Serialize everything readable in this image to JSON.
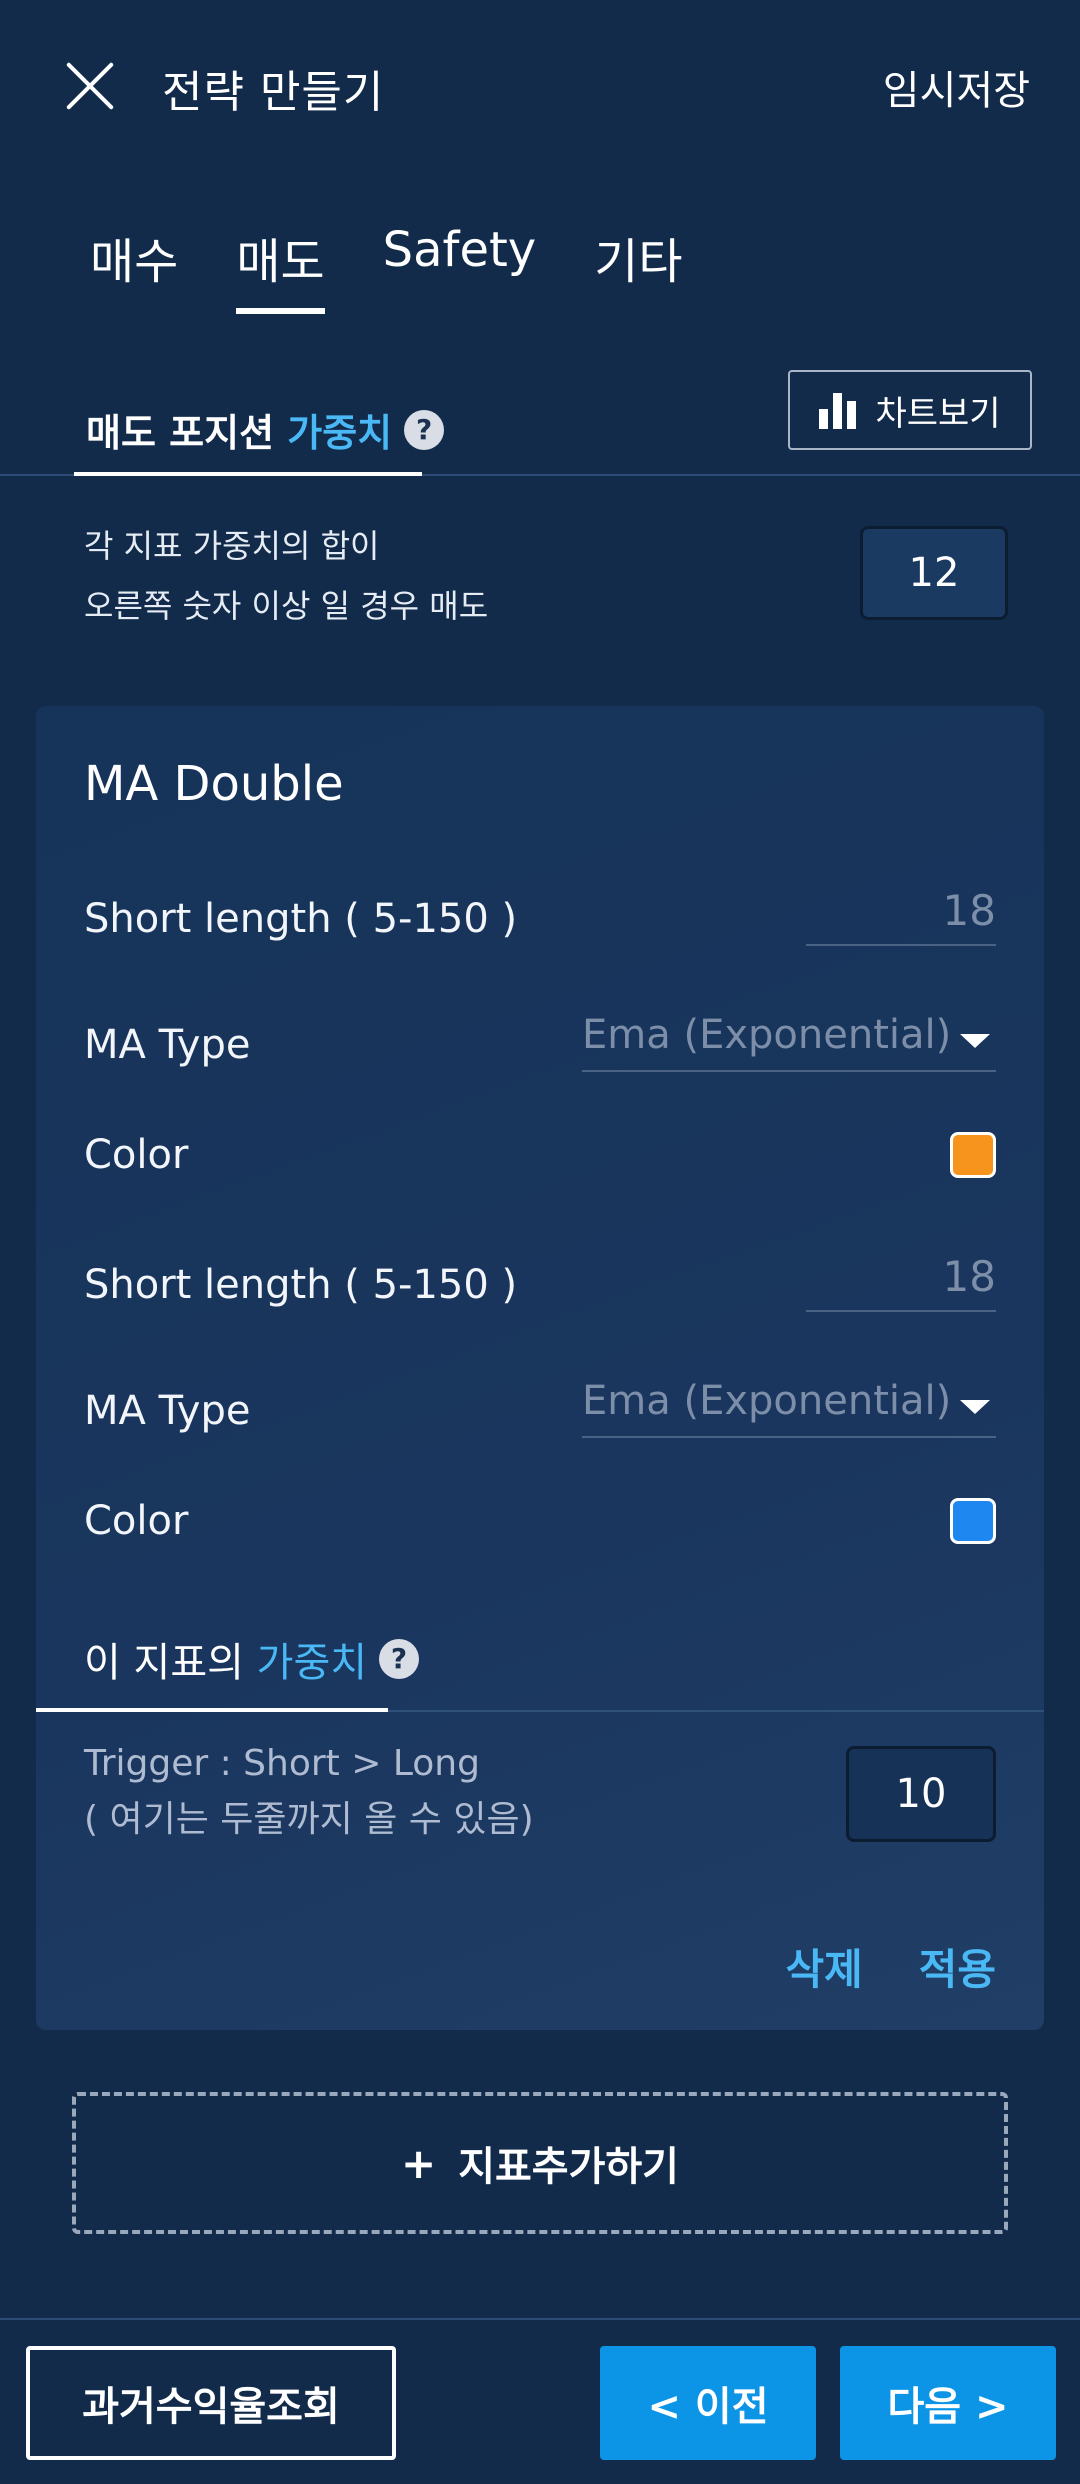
{
  "header": {
    "title": "전략 만들기",
    "save_label": "임시저장"
  },
  "tabs": [
    {
      "label": "매수",
      "active": false
    },
    {
      "label": "매도",
      "active": true
    },
    {
      "label": "Safety",
      "active": false
    },
    {
      "label": "기타",
      "active": false
    }
  ],
  "section": {
    "title_prefix": "매도 포지션",
    "title_accent": "가중치",
    "help_glyph": "?",
    "chart_button_label": "차트보기",
    "threshold_line1": "각 지표 가중치의 합이",
    "threshold_line2": "오른쪽 숫자 이상 일 경우 매도",
    "threshold_value": "12"
  },
  "indicator_card": {
    "title": "MA Double",
    "short1_label": "Short length ( 5-150 )",
    "short1_value": "18",
    "type1_label": "MA Type",
    "type1_value": "Ema (Exponential)",
    "color1_label": "Color",
    "color1_hex": "#f7941d",
    "short2_label": "Short length ( 5-150 )",
    "short2_value": "18",
    "type2_label": "MA Type",
    "type2_value": "Ema (Exponential)",
    "color2_label": "Color",
    "color2_hex": "#1e88f0",
    "weight_title_prefix": "이 지표의",
    "weight_title_accent": "가중치",
    "trigger_line1": "Trigger : Short > Long",
    "trigger_line2": "( 여기는 두줄까지 올 수 있음)",
    "weight_value": "10",
    "delete_label": "삭제",
    "apply_label": "적용"
  },
  "add_indicator": {
    "plus": "+",
    "label": "지표추가하기"
  },
  "footer": {
    "history_label": "과거수익율조회",
    "prev_label": "< 이전",
    "next_label": "다음 >"
  },
  "colors": {
    "accent": "#4ab8f5",
    "primary_button": "#0c95e6",
    "background": "#122b4b"
  }
}
